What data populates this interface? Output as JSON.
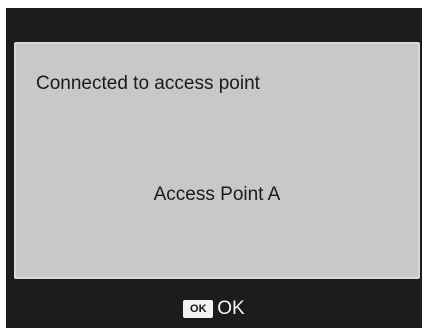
{
  "dialog": {
    "message": "Connected to access point",
    "access_point_name": "Access Point A"
  },
  "footer": {
    "ok_key_label": "OK",
    "ok_action_label": "OK"
  },
  "colors": {
    "screen_background": "#1c1c1c",
    "dialog_background": "#c8c8c8",
    "text_dark": "#1a1a1a",
    "text_light": "#f5f5f5"
  }
}
